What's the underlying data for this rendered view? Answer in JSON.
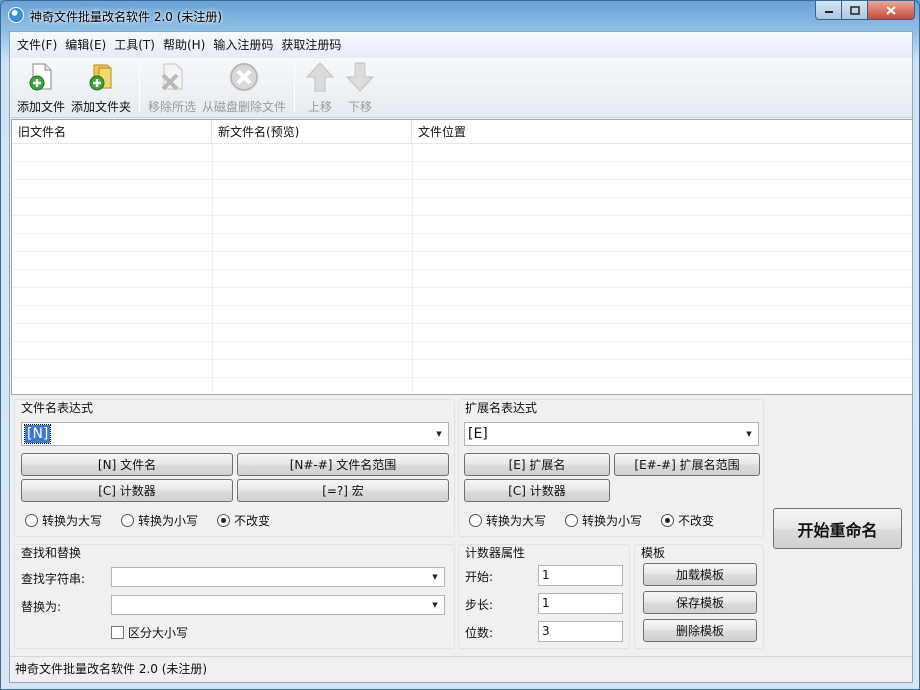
{
  "window": {
    "title": "神奇文件批量改名软件 2.0 (未注册)"
  },
  "menu": [
    {
      "label": "文件(F)"
    },
    {
      "label": "编辑(E)"
    },
    {
      "label": "工具(T)"
    },
    {
      "label": "帮助(H)"
    },
    {
      "label": "输入注册码"
    },
    {
      "label": "获取注册码"
    }
  ],
  "toolbar": {
    "add_file": "添加文件",
    "add_folder": "添加文件夹",
    "remove_selected": "移除所选",
    "delete_from_disk": "从磁盘删除文件",
    "move_up": "上移",
    "move_down": "下移"
  },
  "file_list": {
    "columns": [
      "旧文件名",
      "新文件名(预览)",
      "文件位置"
    ],
    "rows": []
  },
  "filename_expr": {
    "title": "文件名表达式",
    "value": "[N]",
    "btn_name": "[N] 文件名",
    "btn_range": "[N#-#] 文件名范围",
    "btn_counter": "[C] 计数器",
    "btn_macro": "[=?] 宏",
    "case_upper": "转换为大写",
    "case_lower": "转换为小写",
    "case_keep": "不改变",
    "case_selected": "keep"
  },
  "ext_expr": {
    "title": "扩展名表达式",
    "value": "[E]",
    "btn_ext": "[E] 扩展名",
    "btn_range": "[E#-#] 扩展名范围",
    "btn_counter": "[C] 计数器",
    "case_upper": "转换为大写",
    "case_lower": "转换为小写",
    "case_keep": "不改变",
    "case_selected": "keep"
  },
  "start_button": "开始重命名",
  "find_replace": {
    "title": "查找和替换",
    "find_label": "查找字符串:",
    "find_value": "",
    "replace_label": "替换为:",
    "replace_value": "",
    "match_case": "区分大小写"
  },
  "counter": {
    "title": "计数器属性",
    "start_label": "开始:",
    "start_value": "1",
    "step_label": "步长:",
    "step_value": "1",
    "digits_label": "位数:",
    "digits_value": "3"
  },
  "template": {
    "title": "模板",
    "load": "加载模板",
    "save": "保存模板",
    "delete": "删除模板"
  },
  "status": {
    "text": "神奇文件批量改名软件 2.0 (未注册)"
  },
  "icons": {
    "add_file": "add-file-icon",
    "add_folder": "add-folder-icon",
    "remove": "remove-icon",
    "delete": "delete-icon",
    "up": "arrow-up-icon",
    "down": "arrow-down-icon"
  },
  "colors": {
    "accent_green": "#2e9a2e",
    "selection": "#3b79d4"
  }
}
